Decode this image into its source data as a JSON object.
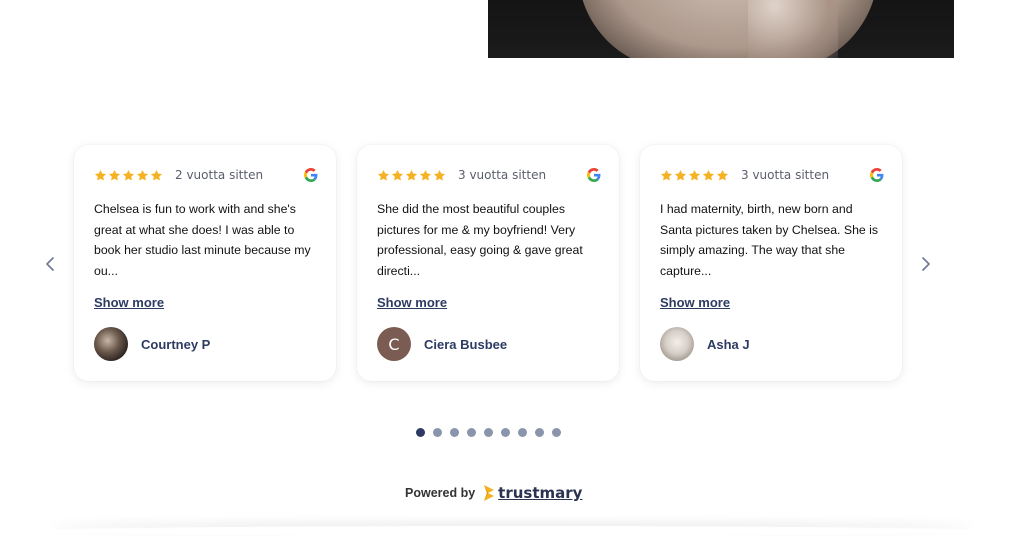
{
  "hero": {
    "image_alt": ""
  },
  "carousel": {
    "reviews": [
      {
        "stars": 5,
        "date": "2 vuotta sitten",
        "source_icon": "google-icon",
        "text": "Chelsea is fun to work with and she's great at what she does! I was able to book her studio last minute because my ou...",
        "show_more": "Show more",
        "author": "Courtney P",
        "avatar": "photo"
      },
      {
        "stars": 5,
        "date": "3 vuotta sitten",
        "source_icon": "google-icon",
        "text": "She did the most beautiful couples pictures for me & my boyfriend! Very professional, easy going & gave great directi...",
        "show_more": "Show more",
        "author": "Ciera Busbee",
        "avatar_letter": "C"
      },
      {
        "stars": 5,
        "date": "3 vuotta sitten",
        "source_icon": "google-icon",
        "text": "I had maternity, birth, new born and Santa pictures taken by Chelsea. She is simply amazing. The way that she capture...",
        "show_more": "Show more",
        "author": "Asha J",
        "avatar": "photo"
      }
    ],
    "pagination": {
      "total": 9,
      "active": 1
    },
    "colors": {
      "star": "#f5b324",
      "accent": "#2d3b63"
    }
  },
  "footer": {
    "powered_by": "Powered by",
    "brand": "trustmary"
  }
}
